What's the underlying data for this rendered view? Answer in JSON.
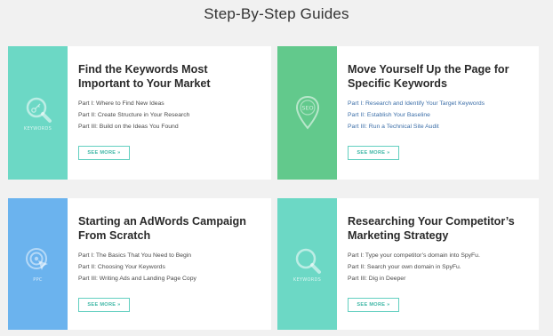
{
  "page": {
    "title": "Step-By-Step Guides"
  },
  "colors": {
    "teal": "#6cd8c5",
    "green": "#62c98c",
    "blue": "#6bb3ee",
    "button_border": "#62cfc0",
    "link": "#3d6fa8"
  },
  "cards": [
    {
      "title": "Find the Keywords Most Important to Your Market",
      "side_label": "KEYWORDS",
      "icon": "magnifier-key-icon",
      "parts": [
        "Part I: Where to Find New Ideas",
        "Part II: Create Structure in Your Research",
        "Part III: Build on the Ideas You Found"
      ],
      "button": "SEE MORE »"
    },
    {
      "title": "Move Yourself Up the Page for Specific Keywords",
      "side_label": "",
      "icon": "seo-map-pin-icon",
      "icon_text": "SEO",
      "parts": [
        "Part I: Research and Identify Your Target Keywords",
        "Part II: Establish Your Baseline",
        "Part III: Run a Technical Site Audit"
      ],
      "button": "SEE MORE »"
    },
    {
      "title": "Starting an AdWords Campaign From Scratch",
      "side_label": "PPC",
      "icon": "target-cursor-icon",
      "parts": [
        "Part I: The Basics That You Need to Begin",
        "Part II: Choosing Your Keywords",
        "Part III: Writing Ads and Landing Page Copy"
      ],
      "button": "SEE MORE »"
    },
    {
      "title": "Researching Your Competitor’s Marketing Strategy",
      "side_label": "KEYWORDS",
      "icon": "magnifier-icon",
      "parts": [
        "Part I: Type your competitor’s domain into SpyFu.",
        "Part II: Search your own domain in SpyFu.",
        "Part III: Dig in Deeper"
      ],
      "button": "SEE MORE »"
    }
  ]
}
